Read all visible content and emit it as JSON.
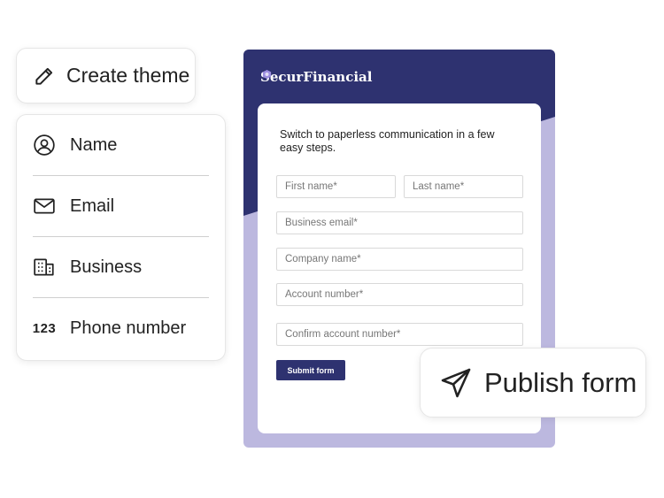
{
  "create_theme": {
    "label": "Create theme",
    "icon": "pencil-icon"
  },
  "fields": {
    "items": [
      {
        "label": "Name",
        "icon": "user-circle-icon"
      },
      {
        "label": "Email",
        "icon": "mail-icon"
      },
      {
        "label": "Business",
        "icon": "building-icon"
      },
      {
        "label": "Phone number",
        "icon_text": "123"
      }
    ]
  },
  "form": {
    "brand_left": "Secur",
    "brand_right": "Financial",
    "intro": "Switch to paperless communication in a few easy steps.",
    "first_name_placeholder": "First name*",
    "last_name_placeholder": "Last name*",
    "business_email_placeholder": "Business email*",
    "company_name_placeholder": "Company name*",
    "account_number_placeholder": "Account number*",
    "confirm_account_placeholder": "Confirm account number*",
    "submit_label": "Submit form"
  },
  "publish": {
    "label": "Publish form",
    "icon": "send-icon"
  },
  "colors": {
    "brand_dark": "#2e3270",
    "brand_light": "#bcb8df",
    "brand_accent": "#9d8fe0"
  }
}
